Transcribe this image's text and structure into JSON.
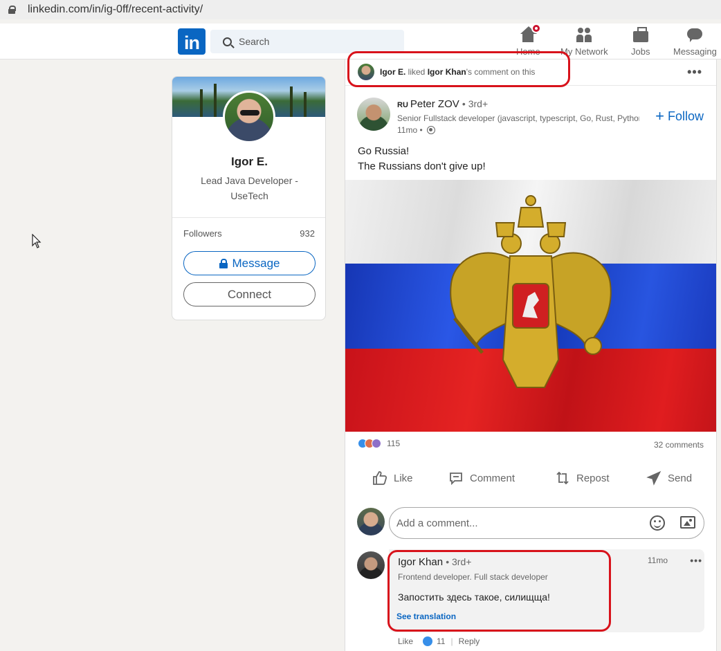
{
  "browser": {
    "url": "linkedin.com/in/ig-0ff/recent-activity/"
  },
  "nav": {
    "logo": "in",
    "search_placeholder": "Search",
    "items": [
      {
        "label": "Home",
        "icon": "home-icon"
      },
      {
        "label": "My Network",
        "icon": "network-icon"
      },
      {
        "label": "Jobs",
        "icon": "briefcase-icon"
      },
      {
        "label": "Messaging",
        "icon": "messaging-icon"
      }
    ]
  },
  "profile": {
    "name": "Igor E.",
    "title": "Lead Java Developer - UseTech",
    "followers_label": "Followers",
    "followers_count": "932",
    "message_label": "Message",
    "connect_label": "Connect"
  },
  "activity": {
    "actor": "Igor E.",
    "verb": " liked ",
    "target": "Igor Khan",
    "suffix": "'s comment on this"
  },
  "post": {
    "country_code": "RU",
    "author": "Peter ZOV",
    "degree": "• 3rd+",
    "headline": "Senior Fullstack developer (javascript, typescript, Go, Rust, Python)",
    "time": "11mo •",
    "follow_label": "Follow",
    "text_line1": "Go Russia!",
    "text_line2": "The Russians don't give up!",
    "reactions_count": "115",
    "comments_count": "32 comments",
    "actions": {
      "like": "Like",
      "comment": "Comment",
      "repost": "Repost",
      "send": "Send"
    }
  },
  "comment_input": {
    "placeholder": "Add a comment..."
  },
  "comment": {
    "author": "Igor Khan",
    "degree": "• 3rd+",
    "headline": "Frontend developer. Full stack developer",
    "time": "11mo",
    "text": "Запостить здесь такое, силищща!",
    "see_translation": "See translation",
    "like_label": "Like",
    "like_count": "11",
    "reply_label": "Reply"
  },
  "colors": {
    "brand": "#0a66c2",
    "highlight": "#d8121b",
    "page_bg": "#f3f2ef"
  }
}
